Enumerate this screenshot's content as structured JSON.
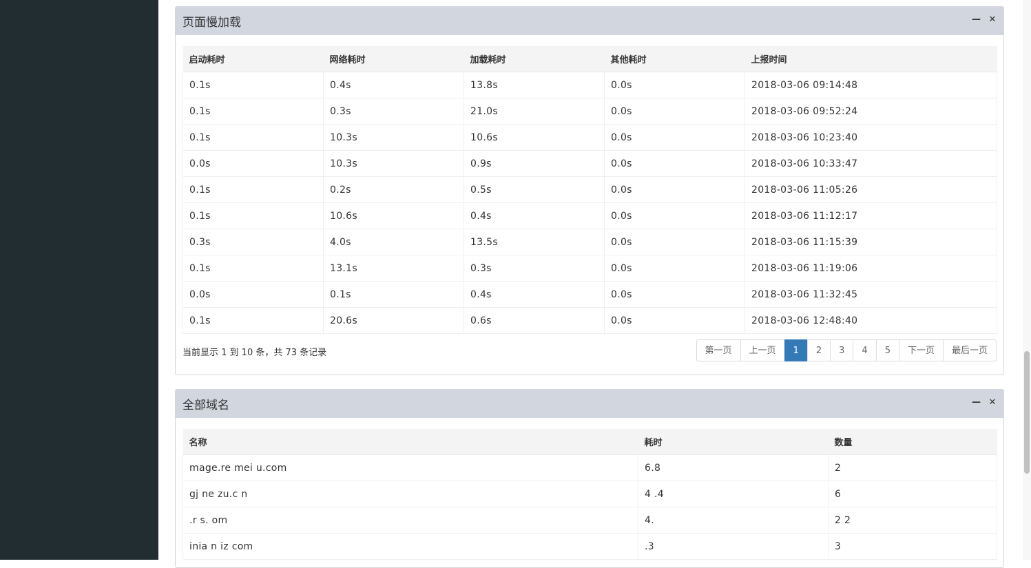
{
  "slow_load": {
    "title": "页面慢加载",
    "columns": [
      "启动耗时",
      "网络耗时",
      "加载耗时",
      "其他耗时",
      "上报时间"
    ],
    "rows": [
      [
        "0.1s",
        "0.4s",
        "13.8s",
        "0.0s",
        "2018-03-06 09:14:48"
      ],
      [
        "0.1s",
        "0.3s",
        "21.0s",
        "0.0s",
        "2018-03-06 09:52:24"
      ],
      [
        "0.1s",
        "10.3s",
        "10.6s",
        "0.0s",
        "2018-03-06 10:23:40"
      ],
      [
        "0.0s",
        "10.3s",
        "0.9s",
        "0.0s",
        "2018-03-06 10:33:47"
      ],
      [
        "0.1s",
        "0.2s",
        "0.5s",
        "0.0s",
        "2018-03-06 11:05:26"
      ],
      [
        "0.1s",
        "10.6s",
        "0.4s",
        "0.0s",
        "2018-03-06 11:12:17"
      ],
      [
        "0.3s",
        "4.0s",
        "13.5s",
        "0.0s",
        "2018-03-06 11:15:39"
      ],
      [
        "0.1s",
        "13.1s",
        "0.3s",
        "0.0s",
        "2018-03-06 11:19:06"
      ],
      [
        "0.0s",
        "0.1s",
        "0.4s",
        "0.0s",
        "2018-03-06 11:32:45"
      ],
      [
        "0.1s",
        "20.6s",
        "0.6s",
        "0.0s",
        "2018-03-06 12:48:40"
      ]
    ],
    "record_info": "当前显示 1 到 10 条，共 73 条记录",
    "pagination": {
      "first": "第一页",
      "prev": "上一页",
      "pages": [
        "1",
        "2",
        "3",
        "4",
        "5"
      ],
      "active_page": "1",
      "next": "下一页",
      "last": "最后一页"
    }
  },
  "all_domains": {
    "title": "全部域名",
    "columns": [
      "名称",
      "耗时",
      "数量"
    ],
    "rows": [
      [
        "mage.re  mei  u.com",
        "6.8",
        "2"
      ],
      [
        "gj  ne  zu.c  n",
        "4  .4",
        "6"
      ],
      [
        ".r  s.  om",
        "4.",
        "2  2"
      ],
      [
        "inia    n  iz  com",
        ".3",
        "3"
      ]
    ]
  },
  "icons": {
    "collapse": "minus-icon",
    "close": "close-icon"
  },
  "colors": {
    "sidebar": "#222d32",
    "box_header": "#d2d6de",
    "active_page": "#337ab7"
  }
}
